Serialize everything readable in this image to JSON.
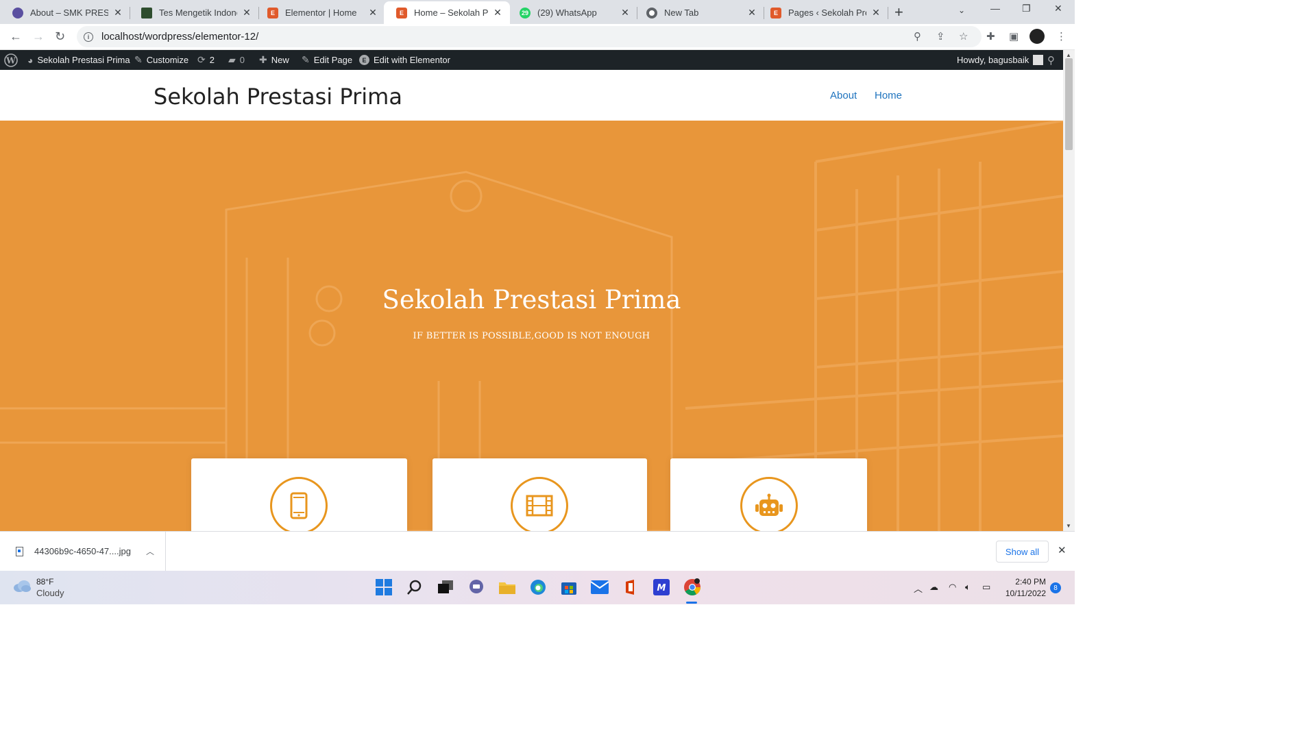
{
  "browser": {
    "tabs": [
      {
        "title": "About – SMK PRESTASI PRIMA",
        "favicon": "site-icon",
        "color": "#5a4fa0"
      },
      {
        "title": "Tes Mengetik Indonesia",
        "favicon": "typing-icon",
        "color": "#2e4d2e"
      },
      {
        "title": "Elementor | Home",
        "favicon": "elementor-icon",
        "color": "#e05a2b"
      },
      {
        "title": "Home – Sekolah Prestasi Prima",
        "favicon": "elementor-icon",
        "color": "#e05a2b"
      },
      {
        "title": "(29) WhatsApp",
        "favicon": "whatsapp-icon",
        "color": "#25d366",
        "badge": "29"
      },
      {
        "title": "New Tab",
        "favicon": "chrome-icon",
        "color": "#5f6368"
      },
      {
        "title": "Pages ‹ Sekolah Prestasi Prima",
        "favicon": "elementor-icon",
        "color": "#e05a2b"
      }
    ],
    "active_tab": 3,
    "url": "localhost/wordpress/elementor-12/"
  },
  "adminbar": {
    "site_name": "Sekolah Prestasi Prima",
    "customize": "Customize",
    "updates": "2",
    "comments": "0",
    "new": "New",
    "edit_page": "Edit Page",
    "edit_elementor": "Edit with Elementor",
    "howdy": "Howdy, bagusbaik"
  },
  "site": {
    "title": "Sekolah Prestasi Prima",
    "menu": [
      "About",
      "Home"
    ]
  },
  "hero": {
    "title": "Sekolah Prestasi Prima",
    "subtitle": "IF BETTER IS POSSIBLE,GOOD IS NOT ENOUGH",
    "color": "#e8963a",
    "cards": [
      {
        "icon": "mobile-phone-icon"
      },
      {
        "icon": "film-icon"
      },
      {
        "icon": "robot-icon"
      }
    ]
  },
  "downloads": {
    "file_name": "44306b9c-4650-47....jpg",
    "show_all": "Show all"
  },
  "taskbar": {
    "weather_temp": "88°F",
    "weather_cond": "Cloudy",
    "time": "2:40 PM",
    "date": "10/11/2022",
    "notifications": "8"
  }
}
